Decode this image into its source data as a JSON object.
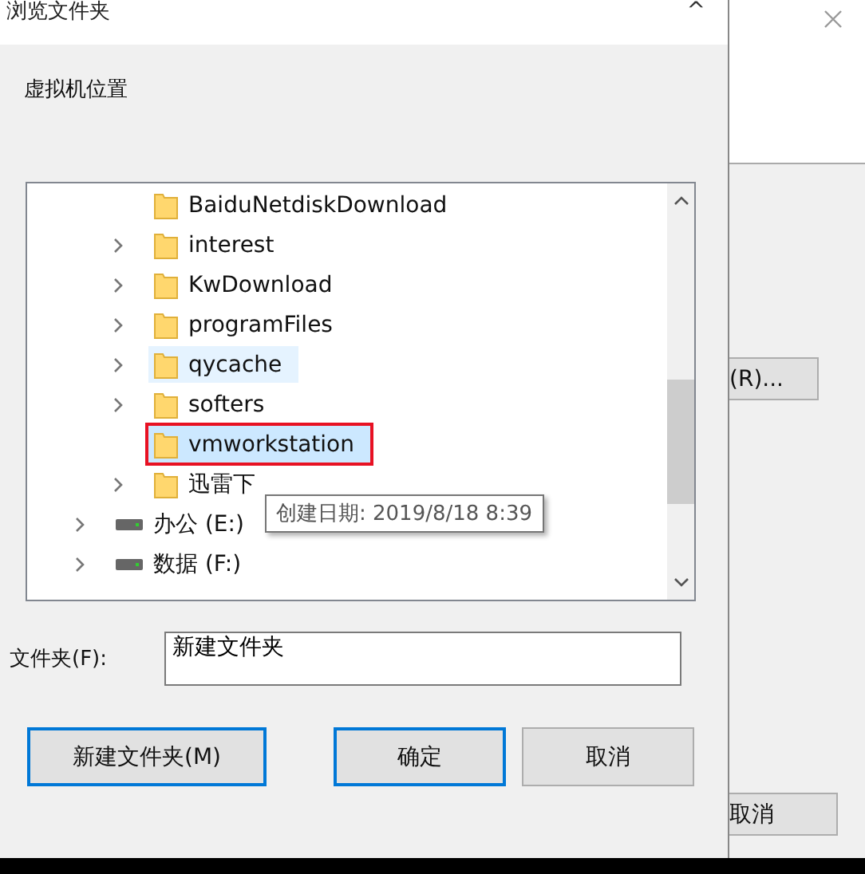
{
  "dialog": {
    "title": "浏览文件夹",
    "close": "^",
    "prompt": "虚拟机位置",
    "tree": {
      "folders": [
        {
          "label": "BaiduNetdiskDownload",
          "expandable": false,
          "selected": false,
          "hovered": false
        },
        {
          "label": "interest",
          "expandable": true,
          "selected": false,
          "hovered": false
        },
        {
          "label": "KwDownload",
          "expandable": true,
          "selected": false,
          "hovered": false
        },
        {
          "label": "programFiles",
          "expandable": true,
          "selected": false,
          "hovered": false
        },
        {
          "label": "qycache",
          "expandable": true,
          "selected": false,
          "hovered": true
        },
        {
          "label": "softers",
          "expandable": true,
          "selected": false,
          "hovered": false
        },
        {
          "label": "vmworkstation",
          "expandable": false,
          "selected": true,
          "hovered": false
        },
        {
          "label": "迅雷下",
          "expandable": true,
          "selected": false,
          "hovered": false
        }
      ],
      "drives": [
        {
          "label": "办公 (E:)",
          "expandable": true,
          "selected": false,
          "hovered": false
        },
        {
          "label": "数据 (F:)",
          "expandable": true,
          "selected": false,
          "hovered": false
        }
      ]
    },
    "tooltip": "创建日期: 2019/8/18 8:39",
    "folder_label": "文件夹(F):",
    "folder_value": "新建文件夹",
    "buttons": [
      {
        "label": "新建文件夹(M)",
        "default": true
      },
      {
        "label": "确定",
        "default": true
      },
      {
        "label": "取消",
        "default": false
      }
    ]
  },
  "background_window": {
    "button": "(R)...",
    "cancel": "取消"
  }
}
